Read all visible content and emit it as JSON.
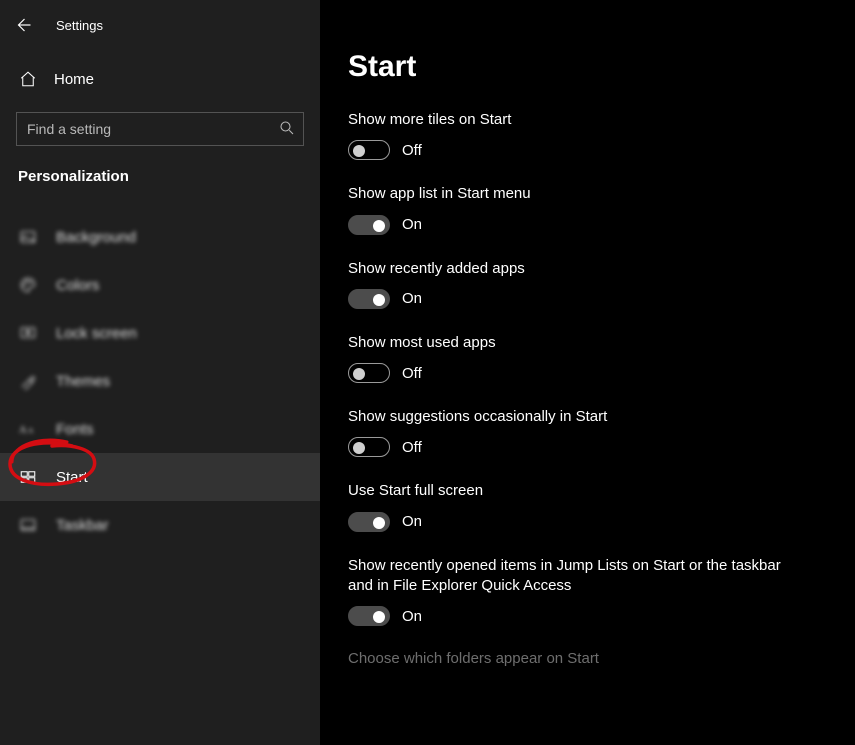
{
  "app_title": "Settings",
  "home_label": "Home",
  "search": {
    "placeholder": "Find a setting"
  },
  "section": "Personalization",
  "nav": [
    {
      "label": "Background",
      "icon": "background",
      "selected": false
    },
    {
      "label": "Colors",
      "icon": "colors",
      "selected": false
    },
    {
      "label": "Lock screen",
      "icon": "lockscreen",
      "selected": false
    },
    {
      "label": "Themes",
      "icon": "themes",
      "selected": false
    },
    {
      "label": "Fonts",
      "icon": "fonts",
      "selected": false
    },
    {
      "label": "Start",
      "icon": "start",
      "selected": true
    },
    {
      "label": "Taskbar",
      "icon": "taskbar",
      "selected": false
    }
  ],
  "page_title": "Start",
  "on_text": "On",
  "off_text": "Off",
  "settings": [
    {
      "label": "Show more tiles on Start",
      "on": false
    },
    {
      "label": "Show app list in Start menu",
      "on": true
    },
    {
      "label": "Show recently added apps",
      "on": true
    },
    {
      "label": "Show most used apps",
      "on": false
    },
    {
      "label": "Show suggestions occasionally in Start",
      "on": false
    },
    {
      "label": "Use Start full screen",
      "on": true
    },
    {
      "label": "Show recently opened items in Jump Lists on Start or the taskbar and in File Explorer Quick Access",
      "on": true
    }
  ],
  "footer_link": "Choose which folders appear on Start"
}
